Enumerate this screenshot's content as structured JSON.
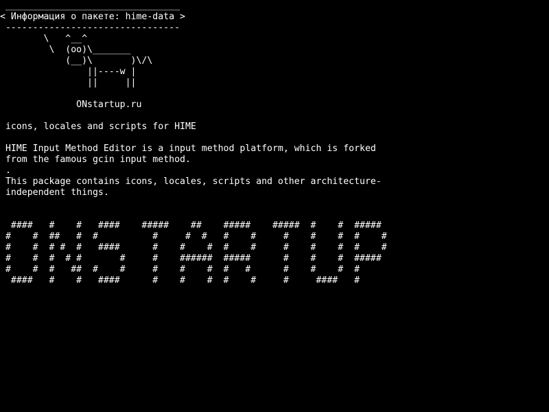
{
  "terminal": {
    "bubble": {
      "top_border": " ________________________________",
      "message": "< Информация о пакете: hime-data >",
      "bottom_border": " --------------------------------"
    },
    "cow": [
      "        \\   ^__^",
      "         \\  (oo)\\_______",
      "            (__)\\       )\\/\\",
      "                ||----w |",
      "                ||     ||"
    ],
    "site_label": "              ONstartup.ru",
    "package_summary": " icons, locales and scripts for HIME",
    "description": [
      " HIME Input Method Editor is a input method platform, which is forked",
      " from the famous gcin input method.",
      " .",
      " This package contains icons, locales, scripts and other architecture-",
      " independent things."
    ],
    "banner": [
      "  ####   #    #   ####    #####    ##    #####    #####  #    #  #####",
      " #    #  ##   #  #          #     #  #   #    #     #    #    #  #    #",
      " #    #  # #  #   ####      #    #    #  #    #     #    #    #  #    #",
      " #    #  #  # #       #     #    ######  #####      #    #    #  #####",
      " #    #  #   ##  #    #     #    #    #  #   #      #    #    #  #",
      "  ####   #    #   ####      #    #    #  #    #     #     ####   #"
    ]
  }
}
